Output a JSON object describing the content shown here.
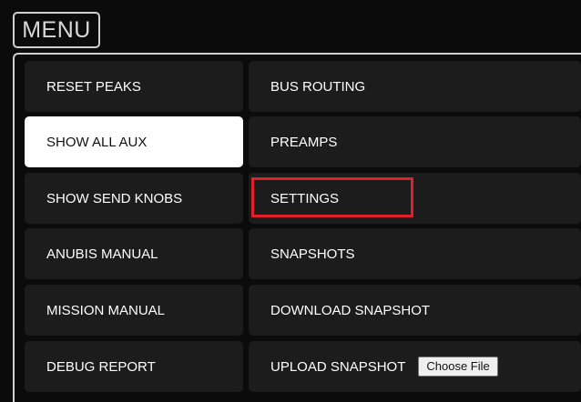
{
  "menu": {
    "title": "MENU"
  },
  "items": {
    "reset_peaks": "RESET PEAKS",
    "bus_routing": "BUS ROUTING",
    "show_all_aux": "SHOW ALL AUX",
    "preamps": "PREAMPS",
    "show_send_knobs": "SHOW SEND KNOBS",
    "settings": "SETTINGS",
    "anubis_manual": "ANUBIS MANUAL",
    "snapshots": "SNAPSHOTS",
    "mission_manual": "MISSION MANUAL",
    "download_snapshot": "DOWNLOAD SNAPSHOT",
    "debug_report": "DEBUG REPORT",
    "upload_snapshot": "UPLOAD SNAPSHOT",
    "choose_file": "Choose File"
  },
  "colors": {
    "background": "#0b0b0b",
    "item": "#1c1c1c",
    "active_item": "#ffffff",
    "highlight": "#e0212a"
  }
}
